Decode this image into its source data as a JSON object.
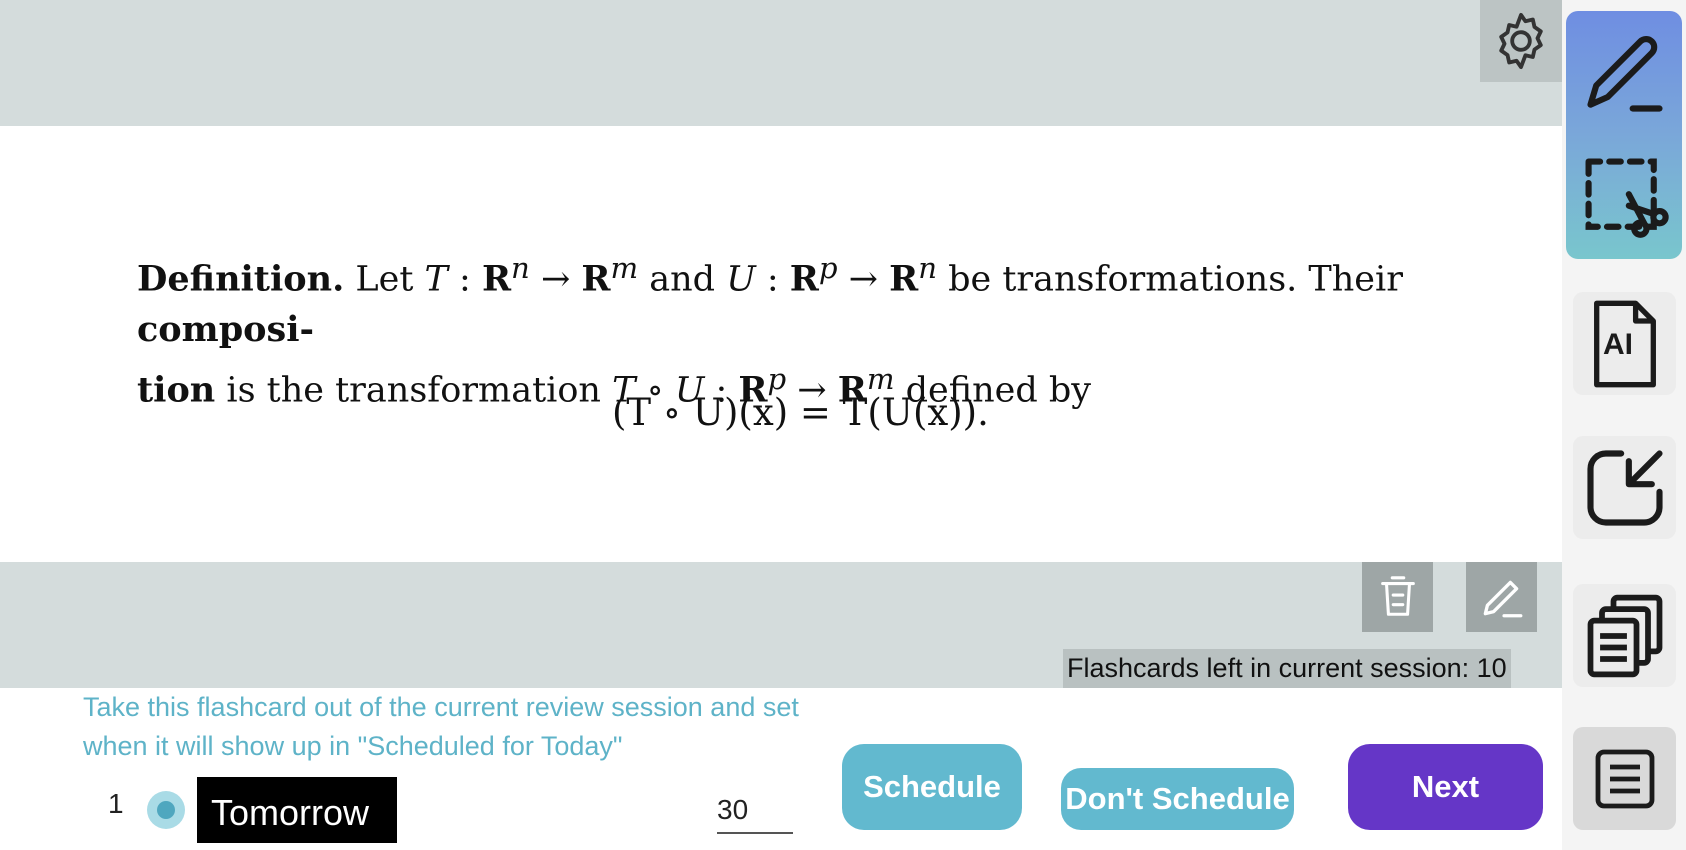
{
  "card": {
    "definition_line1_parts": {
      "bold_lead": "Definition.",
      "text1": " Let ",
      "T": "T",
      "colon1": " : ",
      "R1": "R",
      "n1": "n",
      "arrow1": " → ",
      "R2": "R",
      "m1": "m",
      "and": " and ",
      "U": "U",
      "colon2": " : ",
      "R3": "R",
      "p1": "p",
      "arrow2": " → ",
      "R4": "R",
      "n2": "n",
      "text2": " be transformations. Their ",
      "bold_comp": "composi-"
    },
    "definition_line2_parts": {
      "bold_tion": "tion",
      "text1": " is the transformation ",
      "TU": "T ∘ U",
      "colon": " : ",
      "R1": "R",
      "p": "p",
      "arrow": " → ",
      "R2": "R",
      "m": "m",
      "text2": " defined by"
    },
    "formula": "(T ∘ U)(x) = T(U(x))."
  },
  "session": {
    "counter": "Flashcards left in current session: 10"
  },
  "schedule": {
    "hint": "Take this flashcard out of the current review session and set when it will show up in \"Scheduled for Today\"",
    "interval_count": "1",
    "interval_label": "Tomorrow",
    "days_value": "30"
  },
  "buttons": {
    "schedule": "Schedule",
    "dont_schedule": "Don't Schedule",
    "next": "Next"
  },
  "sidebar": {
    "ai_label": "AI"
  },
  "colors": {
    "accent_teal": "#62b9cf",
    "accent_purple": "#6536c7",
    "band_gray": "#d4dcdc"
  },
  "icons": [
    "gear-icon",
    "trash-icon",
    "pencil-icon",
    "pen-icon",
    "crop-scissors-icon",
    "ai-document-icon",
    "import-arrow-icon",
    "stacked-documents-icon",
    "document-list-icon"
  ]
}
